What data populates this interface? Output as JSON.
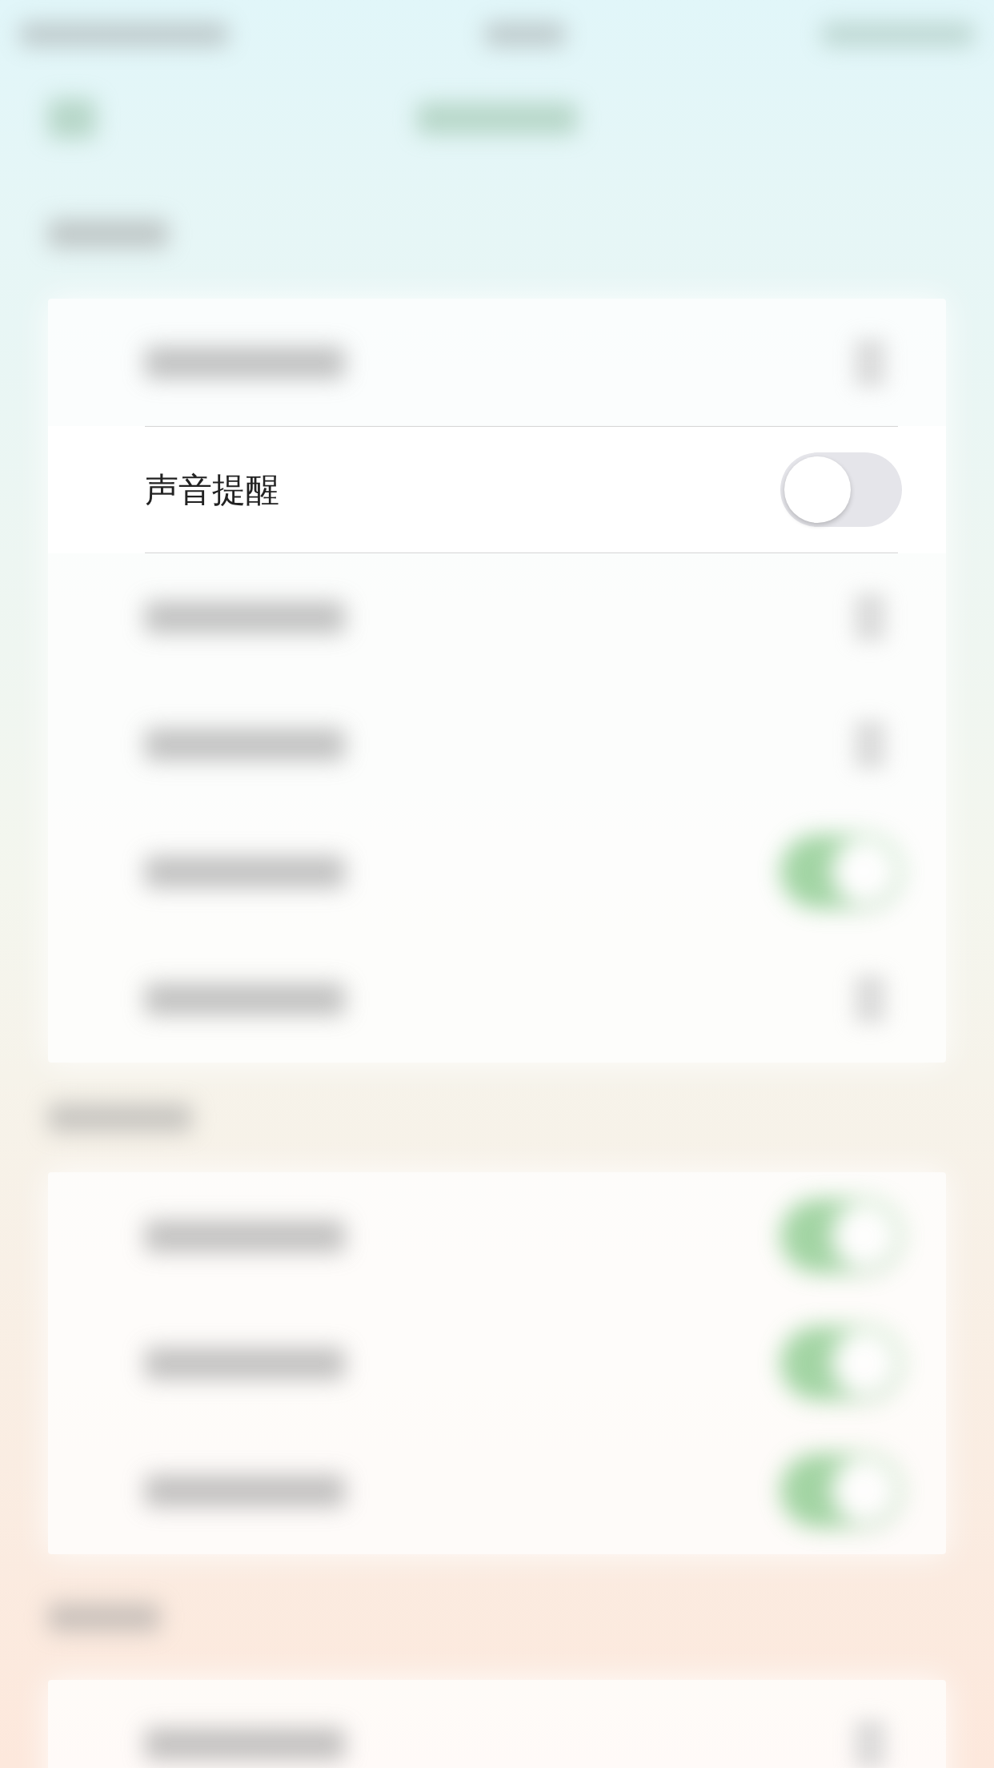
{
  "sections": [
    {
      "rows": [
        {
          "kind": "arrow"
        },
        {
          "kind": "toggle",
          "label": "声音提醒",
          "on": false
        },
        {
          "kind": "arrow"
        },
        {
          "kind": "arrow"
        },
        {
          "kind": "toggle",
          "on": true
        },
        {
          "kind": "arrow"
        }
      ]
    },
    {
      "rows": [
        {
          "kind": "toggle",
          "on": true
        },
        {
          "kind": "toggle",
          "on": true
        },
        {
          "kind": "toggle",
          "on": true
        }
      ]
    },
    {
      "rows": [
        {
          "kind": "arrow"
        }
      ]
    }
  ]
}
